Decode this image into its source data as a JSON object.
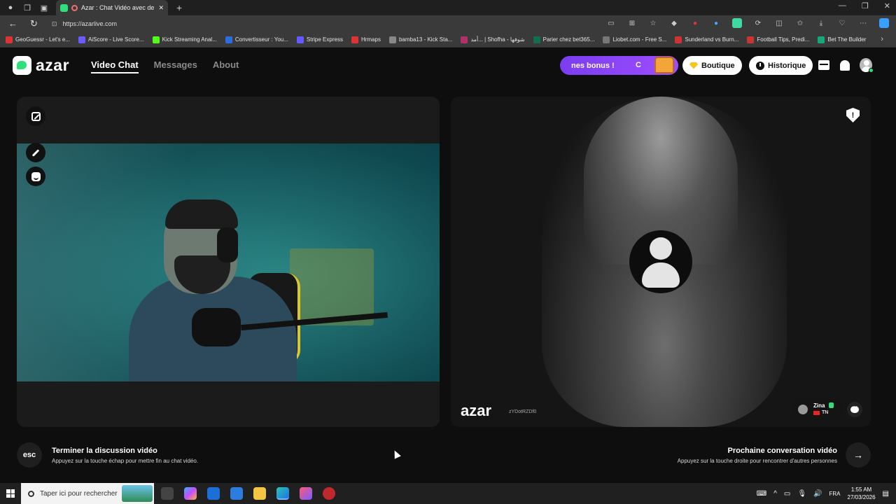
{
  "browser": {
    "tab_title": "Azar : Chat Vidéo avec de n",
    "url": "https://azarlive.com",
    "bookmarks": [
      {
        "label": "GeoGuessr - Let's e...",
        "color": "#d33"
      },
      {
        "label": "AiScore - Live Score...",
        "color": "#6a5cff"
      },
      {
        "label": "Kick Streaming Anal...",
        "color": "#53fc18"
      },
      {
        "label": "Convertisseur : You...",
        "color": "#2b6de0"
      },
      {
        "label": "Stripe Express",
        "color": "#635bff"
      },
      {
        "label": "Hrmaps",
        "color": "#d33"
      },
      {
        "label": "bamba13 - Kick Sta...",
        "color": "#888"
      },
      {
        "label": "أمد... | Shofha - شوفها",
        "color": "#b0306a"
      },
      {
        "label": "Parier chez bet365...",
        "color": "#126e51"
      },
      {
        "label": "Liobet.com - Free S...",
        "color": "#777"
      },
      {
        "label": "Sunderland vs Burn...",
        "color": "#c33"
      },
      {
        "label": "Football Tips, Predi...",
        "color": "#c33"
      },
      {
        "label": "Bet The Builder",
        "color": "#16a87a"
      }
    ]
  },
  "header": {
    "logo_text": "azar",
    "nav": {
      "video_chat": "Video Chat",
      "messages": "Messages",
      "about": "About"
    },
    "bonus_text": "nes bonus !",
    "bonus_suffix": "C",
    "boutique_label": "Boutique",
    "historique_label": "Historique"
  },
  "remote": {
    "watermark": "azar",
    "session_id": "zYDotRZDf0",
    "user_name": "Zina",
    "country": "TN"
  },
  "controls": {
    "esc_key": "esc",
    "end_title": "Terminer la discussion vidéo",
    "end_sub": "Appuyez sur la touche échap pour mettre fin au chat vidéo.",
    "next_title": "Prochaine conversation vidéo",
    "next_sub": "Appuyez sur la touche droite pour rencontrer d'autres personnes",
    "next_key": "→"
  },
  "taskbar": {
    "search_placeholder": "Taper ici pour rechercher",
    "lang": "FRA",
    "time": "1:55 AM",
    "date": "27/03/2026"
  }
}
